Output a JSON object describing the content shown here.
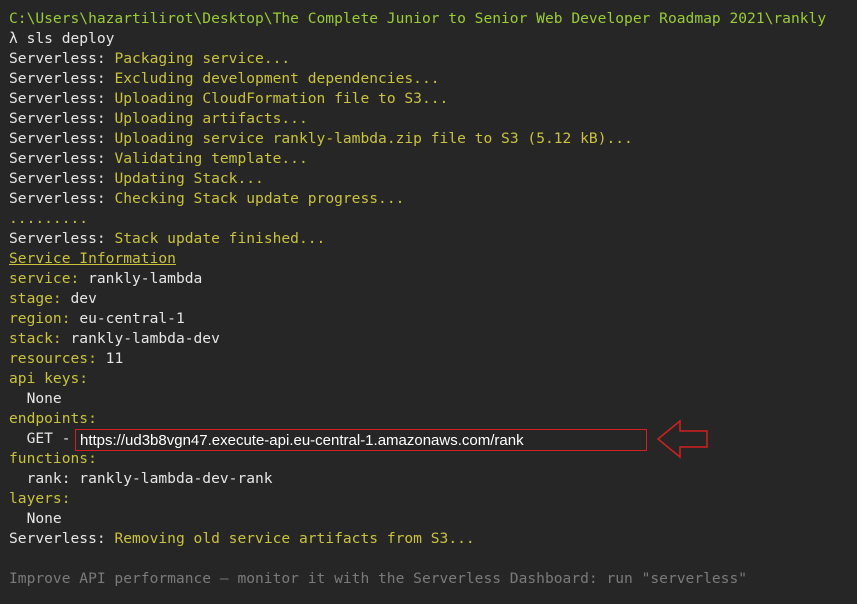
{
  "colors": {
    "background": "#262626",
    "path_green": "#9acd32",
    "label_yellow": "#c9c33b",
    "text_white": "#e6e6e6",
    "hint_gray": "#7a7a7a",
    "highlight_red": "#d31f1f"
  },
  "prompt": {
    "path": "C:\\Users\\hazartilirot\\Desktop\\The Complete Junior to Senior Web Developer Roadmap 2021\\rankly",
    "symbol": "λ",
    "command": "sls deploy"
  },
  "log": {
    "prefix": "Serverless:",
    "steps": [
      "Packaging service...",
      "Excluding development dependencies...",
      "Uploading CloudFormation file to S3...",
      "Uploading artifacts...",
      "Uploading service rankly-lambda.zip file to S3 (5.12 kB)...",
      "Validating template...",
      "Updating Stack...",
      "Checking Stack update progress..."
    ],
    "dots": ".........",
    "finished": "Stack update finished..."
  },
  "info": {
    "heading": "Service Information",
    "service_label": "service:",
    "service_value": "rankly-lambda",
    "stage_label": "stage:",
    "stage_value": "dev",
    "region_label": "region:",
    "region_value": "eu-central-1",
    "stack_label": "stack:",
    "stack_value": "rankly-lambda-dev",
    "resources_label": "resources:",
    "resources_value": "11",
    "api_keys_label": "api keys:",
    "api_keys_value": "None",
    "endpoints_label": "endpoints:",
    "endpoint_method": "GET -",
    "endpoint_url": "https://ud3b8vgn47.execute-api.eu-central-1.amazonaws.com/rank",
    "functions_label": "functions:",
    "function_entry": "rank: rankly-lambda-dev-rank",
    "layers_label": "layers:",
    "layers_value": "None"
  },
  "cleanup": "Removing old service artifacts from S3...",
  "hint": "Improve API performance – monitor it with the Serverless Dashboard: run \"serverless\"",
  "annotation": {
    "arrow_icon": "left-arrow-outline-icon"
  }
}
